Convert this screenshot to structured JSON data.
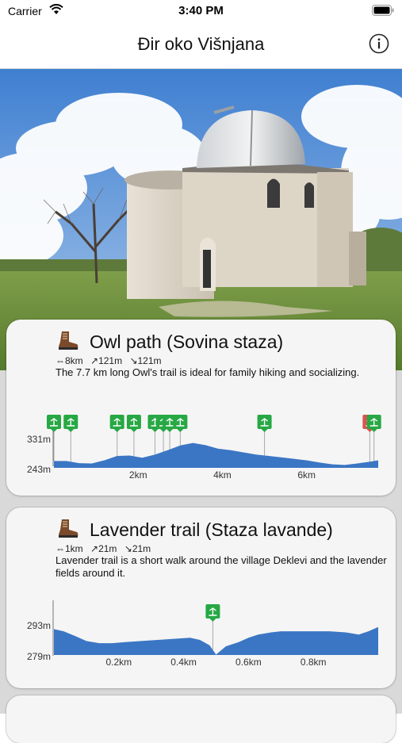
{
  "status_bar": {
    "carrier": "Carrier",
    "time": "3:40 PM"
  },
  "nav": {
    "title": "Đir oko Višnjana",
    "info_icon": "info-circle-icon"
  },
  "hero": {
    "alt": "observatory-photo"
  },
  "trails": [
    {
      "title": "Owl path (Sovina staza)",
      "distance": "⇔8km",
      "ascent": "↗121m",
      "descent": "↘121m",
      "description": "The 7.7 km long Owl's trail is ideal for family hiking and socializing.",
      "y_max_label": "331m",
      "y_min_label": "243m",
      "x_labels": [
        "2km",
        "4km",
        "6km"
      ],
      "chart_data": {
        "type": "area",
        "ylim": [
          243,
          331
        ],
        "xlim": [
          0,
          7.7
        ],
        "x": [
          0,
          0.3,
          0.6,
          0.9,
          1.2,
          1.5,
          1.8,
          2.1,
          2.4,
          2.7,
          3.0,
          3.3,
          3.6,
          3.9,
          4.2,
          4.5,
          4.8,
          5.1,
          5.4,
          5.7,
          6.0,
          6.3,
          6.6,
          6.9,
          7.2,
          7.5,
          7.7
        ],
        "y": [
          262,
          262,
          256,
          255,
          264,
          276,
          277,
          271,
          280,
          292,
          305,
          312,
          306,
          296,
          292,
          286,
          280,
          276,
          272,
          268,
          264,
          258,
          253,
          251,
          255,
          260,
          264
        ],
        "markers": [
          {
            "x": 0.0,
            "icon": "nature-marker-icon",
            "color": "#27a844"
          },
          {
            "x": 0.4,
            "icon": "bench-marker-icon",
            "color": "#27a844"
          },
          {
            "x": 1.5,
            "icon": "grass-marker-icon",
            "color": "#27a844"
          },
          {
            "x": 1.9,
            "icon": "grass-marker-icon",
            "color": "#27a844"
          },
          {
            "x": 2.4,
            "icon": "forest-marker-icon",
            "color": "#27a844"
          },
          {
            "x": 2.6,
            "icon": "tree-marker-icon",
            "color": "#27a844"
          },
          {
            "x": 2.75,
            "icon": "house-marker-icon",
            "color": "#27a844"
          },
          {
            "x": 3.0,
            "icon": "sight-marker-icon",
            "color": "#27a844"
          },
          {
            "x": 5.0,
            "icon": "sight-marker-icon",
            "color": "#27a844"
          },
          {
            "x": 7.5,
            "icon": "info-board-marker-icon",
            "color": "#d9534f"
          },
          {
            "x": 7.6,
            "icon": "nature-marker-icon",
            "color": "#27a844"
          }
        ]
      }
    },
    {
      "title": "Lavender trail (Staza lavande)",
      "distance": "⇔1km",
      "ascent": "↗21m",
      "descent": "↘21m",
      "description": "Lavender trail is a short walk around the village Deklevi and the lavender fields around it.",
      "y_max_label": "293m",
      "y_min_label": "279m",
      "x_labels": [
        "0.2km",
        "0.4km",
        "0.6km",
        "0.8km"
      ],
      "chart_data": {
        "type": "area",
        "ylim": [
          279,
          293
        ],
        "xlim": [
          0,
          1.0
        ],
        "x": [
          0,
          0.03,
          0.07,
          0.1,
          0.14,
          0.18,
          0.22,
          0.27,
          0.32,
          0.37,
          0.42,
          0.45,
          0.48,
          0.5,
          0.53,
          0.57,
          0.6,
          0.63,
          0.67,
          0.7,
          0.75,
          0.8,
          0.85,
          0.9,
          0.94,
          0.97,
          1.0
        ],
        "y": [
          291,
          290,
          287.5,
          285.5,
          284.5,
          284.5,
          285,
          285.5,
          286,
          286.5,
          287,
          286,
          283.5,
          279.2,
          283,
          285,
          287,
          288.5,
          289.5,
          290,
          290,
          290,
          290,
          289.5,
          288.5,
          290,
          292
        ],
        "markers": [
          {
            "x": 0.49,
            "icon": "sight-marker-icon",
            "color": "#27a844"
          }
        ]
      }
    }
  ]
}
